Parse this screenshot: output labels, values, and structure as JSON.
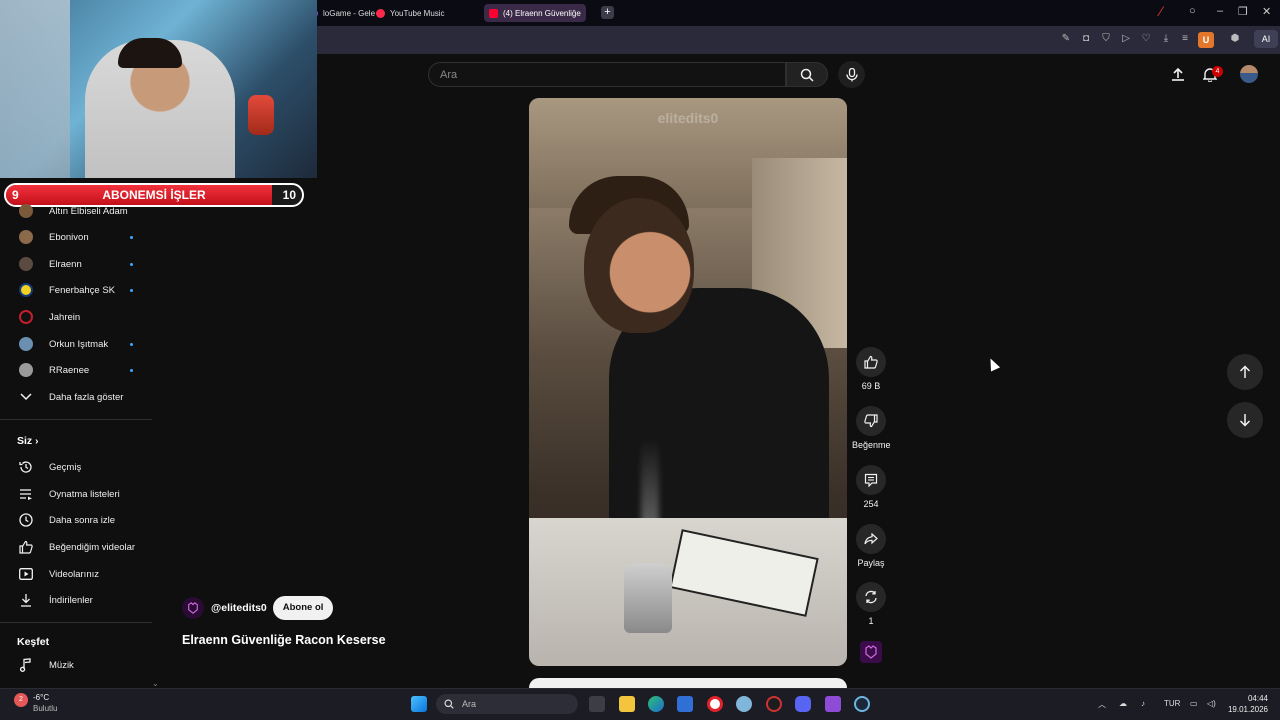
{
  "browser": {
    "tabs": [
      {
        "label": "loGame - Gele",
        "color": "#7a4bd6"
      },
      {
        "label": "YouTube Music",
        "color": "#ff2a4a"
      },
      {
        "label": "(4) Elraenn Güvenliğe",
        "color": "#ff0033"
      }
    ]
  },
  "header": {
    "search_placeholder": "Ara",
    "notification_count": "4"
  },
  "goal": {
    "current": "9",
    "target": "10",
    "title": "ABONEMSİ İŞLER",
    "progress": 0.9
  },
  "sidebar": {
    "subscriptions": [
      {
        "label": "Altın Elbiseli Adam",
        "live": false,
        "color": "#7a5a3a"
      },
      {
        "label": "Ebonivon",
        "live": true,
        "color": "#8a6a4a"
      },
      {
        "label": "Elraenn",
        "live": true,
        "color": "#5a4a40"
      },
      {
        "label": "Fenerbahçe SK",
        "live": true,
        "color": "#f2d024"
      },
      {
        "label": "Jahrein",
        "live": false,
        "color": "#c21f2b"
      },
      {
        "label": "Orkun Işıtmak",
        "live": true,
        "color": "#6b8fb0"
      },
      {
        "label": "RRaenee",
        "live": true,
        "color": "#9a9a9a"
      }
    ],
    "show_more": "Daha fazla göster",
    "you_heading": "Siz",
    "you_items": [
      {
        "label": "Geçmiş",
        "icon": "history-icon"
      },
      {
        "label": "Oynatma listeleri",
        "icon": "playlist-icon"
      },
      {
        "label": "Daha sonra izle",
        "icon": "clock-icon"
      },
      {
        "label": "Beğendiğim videolar",
        "icon": "thumbs-up-icon"
      },
      {
        "label": "Videolarınız",
        "icon": "video-icon"
      },
      {
        "label": "İndirilenler",
        "icon": "download-icon"
      }
    ],
    "explore_heading": "Keşfet",
    "explore_items": [
      {
        "label": "Müzik",
        "icon": "music-icon"
      }
    ]
  },
  "video": {
    "watermark": "elitedits0",
    "channel": "@elitedits0",
    "subscribe_label": "Abone ol",
    "title": "Elraenn Güvenliğe Racon Keserse"
  },
  "actions": {
    "likes": "69 B",
    "dislike_label": "Beğenme",
    "comments": "254",
    "share_label": "Paylaş",
    "remix_count": "1"
  },
  "taskbar": {
    "weather_temp": "-6°C",
    "weather_desc": "Bulutlu",
    "weather_badge": "2",
    "search_label": "Ara",
    "lang": "TUR",
    "time": "04:44",
    "date": "19.01.2026"
  }
}
